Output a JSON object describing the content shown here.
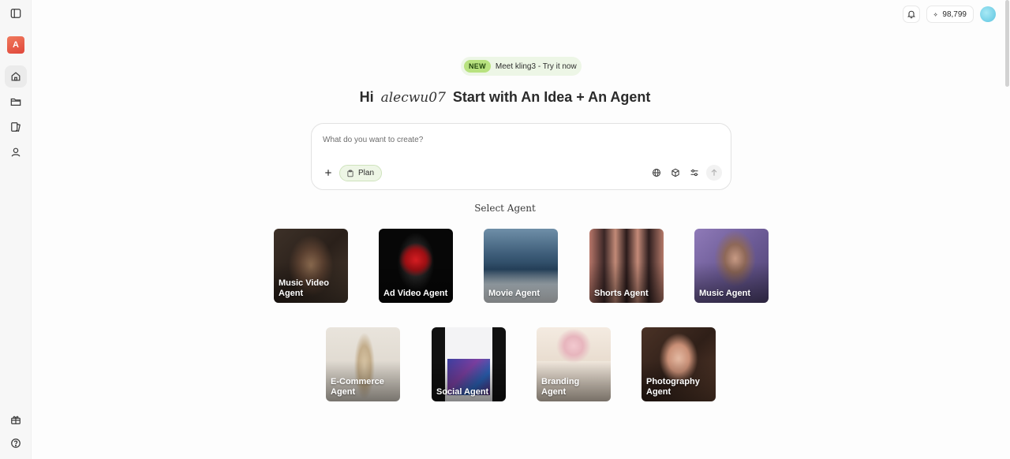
{
  "sidebar": {
    "workspace_initial": "A",
    "items": [
      {
        "icon": "home-icon",
        "name": "sidebar-item-home"
      },
      {
        "icon": "folder-icon",
        "name": "sidebar-item-projects"
      },
      {
        "icon": "library-icon",
        "name": "sidebar-item-library"
      },
      {
        "icon": "user-icon",
        "name": "sidebar-item-profile"
      }
    ]
  },
  "topbar": {
    "credits": "98,799"
  },
  "announcement": {
    "badge": "NEW",
    "text": "Meet kling3 - Try it now"
  },
  "hero": {
    "greeting": "Hi",
    "username": "alecwu07",
    "headline": "Start with An Idea + An Agent"
  },
  "prompt": {
    "placeholder": "What do you want to create?",
    "value": "",
    "plan_label": "Plan"
  },
  "agents": {
    "title": "Select Agent",
    "cards": [
      {
        "label": "Music Video Agent"
      },
      {
        "label": "Ad Video Agent"
      },
      {
        "label": "Movie Agent"
      },
      {
        "label": "Shorts Agent"
      },
      {
        "label": "Music Agent"
      },
      {
        "label": "E-Commerce Agent"
      },
      {
        "label": "Social Agent"
      },
      {
        "label": "Branding Agent"
      },
      {
        "label": "Photography Agent"
      }
    ]
  },
  "colors": {
    "accent_green": "#b8e27f",
    "plan_bg": "#eef6e6",
    "workspace_badge": "#e0473b"
  }
}
